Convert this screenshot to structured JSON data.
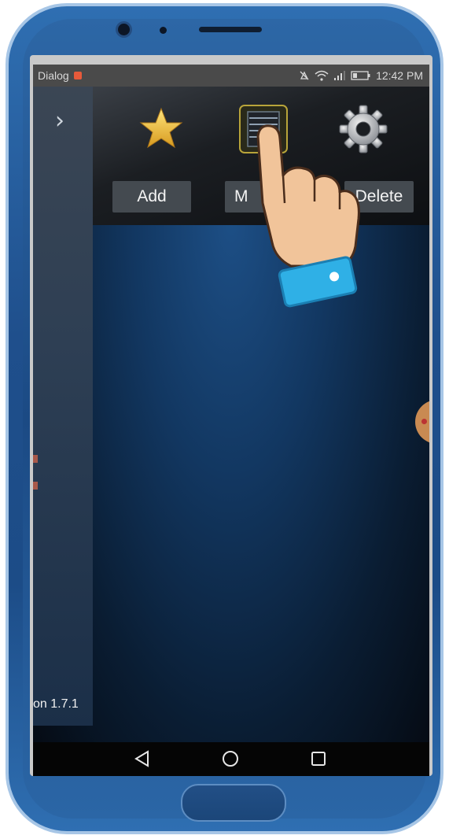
{
  "status_bar": {
    "carrier": "Dialog",
    "time": "12:42 PM"
  },
  "toolbar": {
    "icons": [
      "star-icon",
      "server-icon",
      "gear-icon"
    ],
    "add_label": "Add",
    "m_label": "M",
    "delete_label": "Delete"
  },
  "side_panel": {
    "toggle_icon": "chevron-right-icon",
    "version_text": "on 1.7.1"
  },
  "nav_bar": {
    "icons": [
      "back-icon",
      "home-icon",
      "recents-icon"
    ]
  },
  "colors": {
    "phone_frame": "#2f6fb2",
    "toolbar_bg": "#1b1e22",
    "button_bg": "#444a50",
    "app_bg": "#123761",
    "hand_cuff": "#2fb0e6"
  }
}
